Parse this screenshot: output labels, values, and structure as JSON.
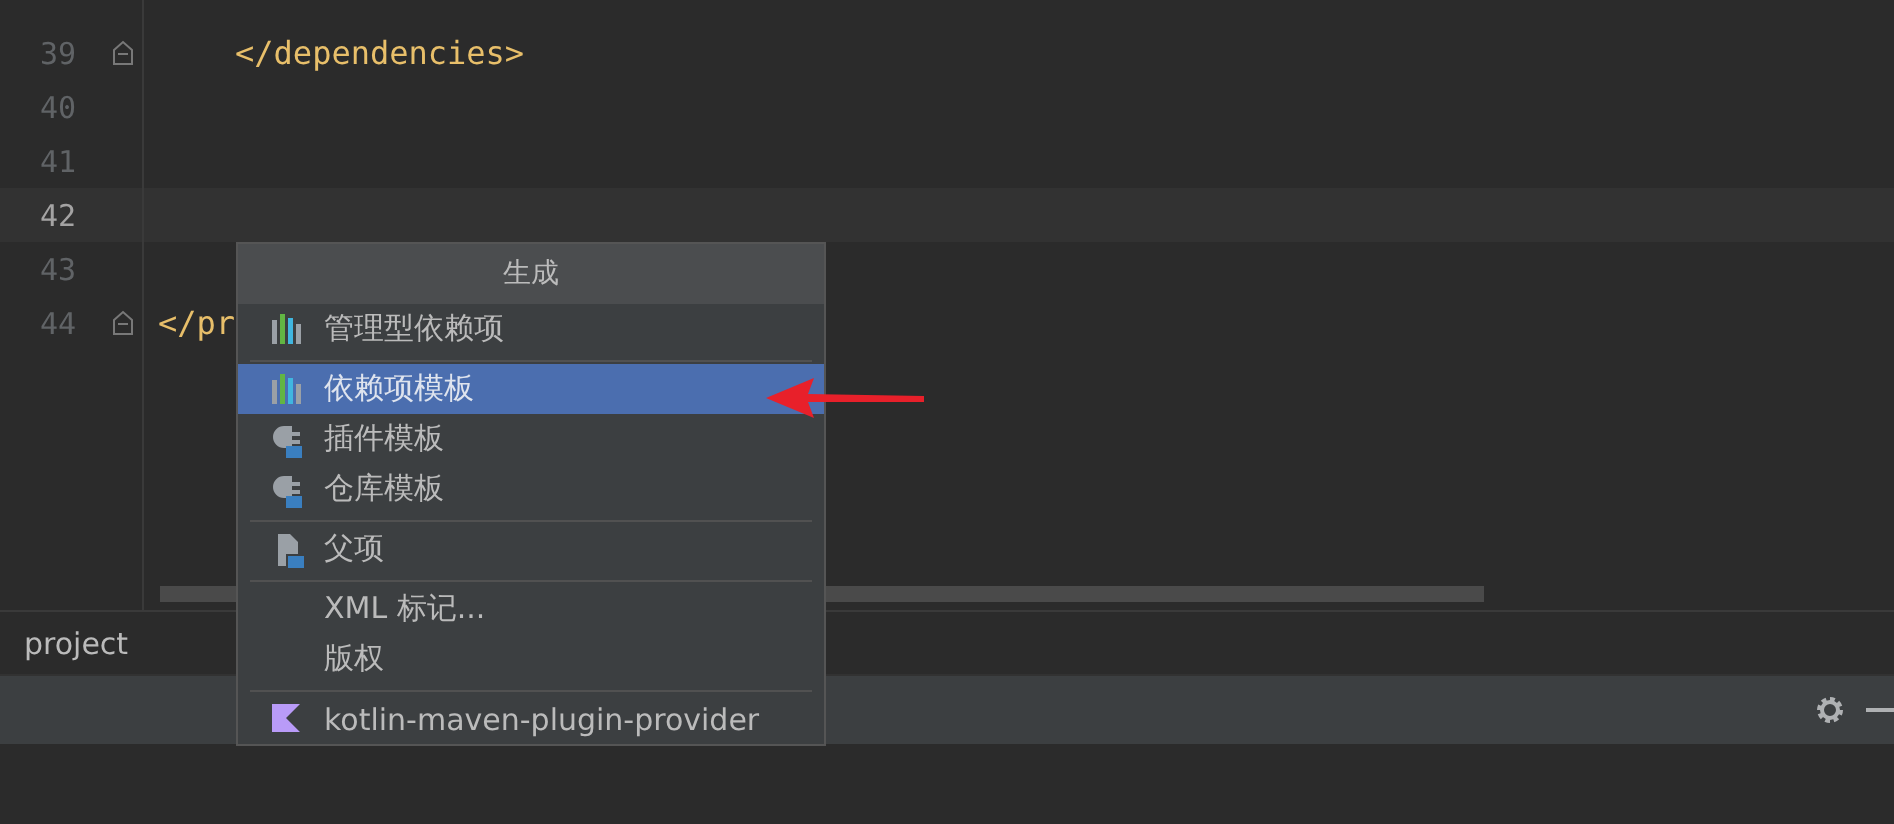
{
  "editor": {
    "lines": [
      {
        "number": "39",
        "text": "    </dependencies>",
        "fold": true,
        "current": false
      },
      {
        "number": "40",
        "fold": false,
        "current": false
      },
      {
        "number": "41",
        "fold": false,
        "current": false
      },
      {
        "number": "42",
        "fold": false,
        "current": true
      },
      {
        "number": "43",
        "fold": false,
        "current": false
      },
      {
        "number": "44",
        "text": "</pr",
        "fold": true,
        "current": false
      }
    ]
  },
  "breadcrumb": "project",
  "popup": {
    "title": "生成",
    "groups": [
      [
        {
          "label": "管理型依赖项",
          "kind": "bars",
          "selected": false
        }
      ],
      [
        {
          "label": "依赖项模板",
          "kind": "bars",
          "selected": true
        },
        {
          "label": "插件模板",
          "kind": "maven",
          "selected": false
        },
        {
          "label": "仓库模板",
          "kind": "maven",
          "selected": false
        }
      ],
      [
        {
          "label": "父项",
          "kind": "maven-file",
          "selected": false
        }
      ],
      [
        {
          "label": "XML 标记...",
          "kind": "plain",
          "selected": false
        },
        {
          "label": "版权",
          "kind": "plain",
          "selected": false
        }
      ],
      [
        {
          "label": "kotlin-maven-plugin-provider",
          "kind": "kotlin",
          "selected": false
        }
      ]
    ]
  }
}
